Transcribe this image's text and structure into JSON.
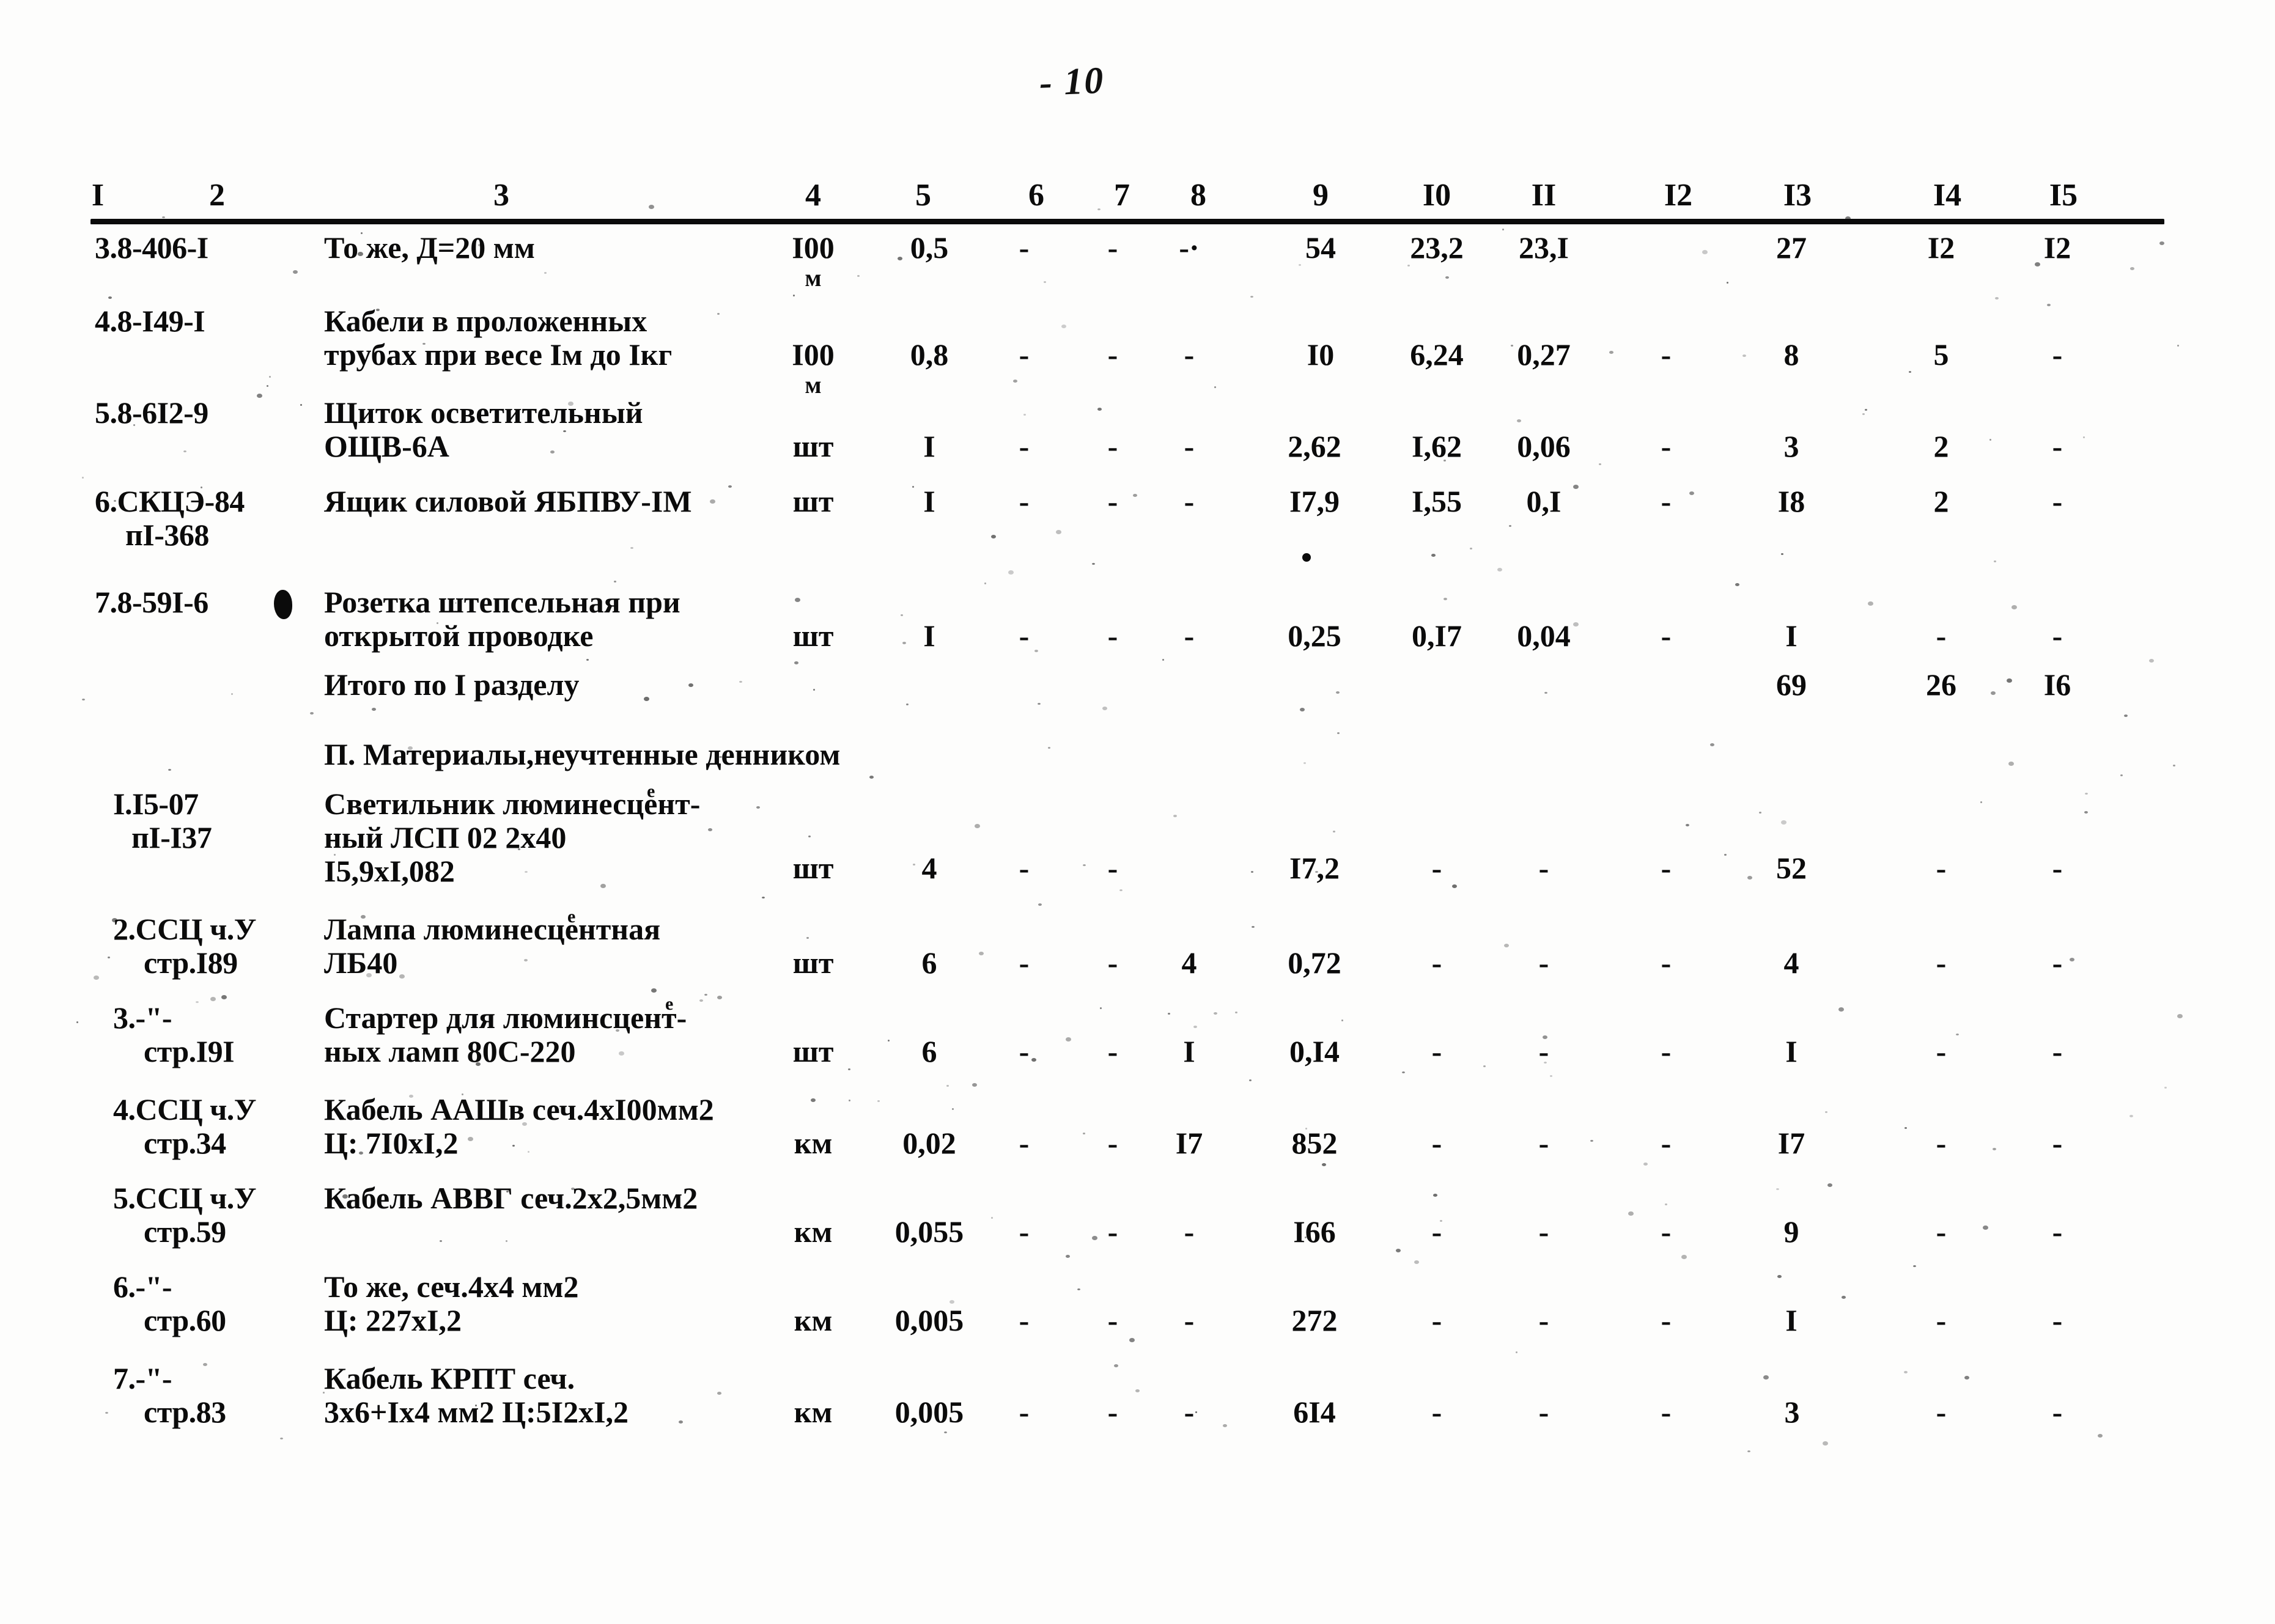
{
  "page": {
    "number_mark": "- 10",
    "paper_color": "#fdfdfc",
    "ink_color": "#0b0b0b"
  },
  "table": {
    "columns": [
      "I",
      "2",
      "3",
      "4",
      "5",
      "6",
      "7",
      "8",
      "9",
      "I0",
      "II",
      "I2",
      "I3",
      "I4",
      "I5"
    ],
    "section1_rows": [
      {
        "code": "3.8-406-I",
        "desc_lines": [
          "То же, Д=20 мм"
        ],
        "unit": "I00",
        "unit2": "м",
        "c5": "0,5",
        "c6": "-",
        "c7": "-",
        "c8": "-·",
        "c9": "54",
        "c10": "23,2",
        "c11": "23,I",
        "c12": "",
        "c13": "27",
        "c14": "I2",
        "c15": "I2"
      },
      {
        "code": "4.8-I49-I",
        "desc_lines": [
          "Кабели в проложенных",
          "трубах при весе Iм до Iкг"
        ],
        "unit": "I00",
        "unit2": "м",
        "c5": "0,8",
        "c6": "-",
        "c7": "-",
        "c8": "-",
        "c9": "I0",
        "c10": "6,24",
        "c11": "0,27",
        "c12": "-",
        "c13": "8",
        "c14": "5",
        "c15": "-"
      },
      {
        "code": "5.8-6I2-9",
        "desc_lines": [
          "Щиток осветительный",
          "ОЩВ-6А"
        ],
        "unit": "шт",
        "unit2": "",
        "c5": "I",
        "c6": "-",
        "c7": "-",
        "c8": "-",
        "c9": "2,62",
        "c10": "I,62",
        "c11": "0,06",
        "c12": "-",
        "c13": "3",
        "c14": "2",
        "c15": "-"
      },
      {
        "code": "6.СКЦЭ-84",
        "code2": "пI-368",
        "desc_lines": [
          "Ящик силовой ЯБПВУ-IМ"
        ],
        "unit": "шт",
        "unit2": "",
        "c5": "I",
        "c6": "-",
        "c7": "-",
        "c8": "-",
        "c9": "I7,9",
        "c10": "I,55",
        "c11": "0,I",
        "c12": "-",
        "c13": "I8",
        "c14": "2",
        "c15": "-"
      },
      {
        "code": "7.8-59I-6",
        "desc_lines": [
          "Розетка штепсельная при",
          "открытой проводке"
        ],
        "unit": "шт",
        "unit2": "",
        "c5": "I",
        "c6": "-",
        "c7": "-",
        "c8": "-",
        "c9": "0,25",
        "c10": "0,I7",
        "c11": "0,04",
        "c12": "-",
        "c13": "I",
        "c14": "-",
        "c15": "-"
      }
    ],
    "total_row": {
      "label": "Итого по I разделу",
      "c13": "69",
      "c14": "26",
      "c15": "I6"
    },
    "section2_heading": "П. Материалы,неучтенные денником",
    "section2_rows": [
      {
        "code": "I.I5-07",
        "code2": "пI-I37",
        "desc_lines": [
          "Светильник люминесцент-",
          "ный ЛСП 02 2х40",
          "I5,9xI,082"
        ],
        "sup_char": "е",
        "unit": "шт",
        "c5": "4",
        "c6": "-",
        "c7": "-",
        "c8": "",
        "c9": "I7,2",
        "c10": "-",
        "c11": "-",
        "c12": "-",
        "c13": "52",
        "c14": "-",
        "c15": "-"
      },
      {
        "code": "2.ССЦ ч.У",
        "code2": "стр.I89",
        "desc_lines": [
          "Лампа люминесцентная",
          "ЛБ40"
        ],
        "sup_char": "е",
        "unit": "шт",
        "c5": "6",
        "c6": "-",
        "c7": "-",
        "c8": "4",
        "c9": "0,72",
        "c10": "-",
        "c11": "-",
        "c12": "-",
        "c13": "4",
        "c14": "-",
        "c15": "-"
      },
      {
        "code": "3.-\"-",
        "code2": "стр.I9I",
        "desc_lines": [
          "Стартер для люминсцент-",
          "ных ламп 80С-220"
        ],
        "sup_char": "е",
        "unit": "шт",
        "c5": "6",
        "c6": "-",
        "c7": "-",
        "c8": "I",
        "c9": "0,I4",
        "c10": "-",
        "c11": "-",
        "c12": "-",
        "c13": "I",
        "c14": "-",
        "c15": "-"
      },
      {
        "code": "4.ССЦ ч.У",
        "code2": "стр.34",
        "desc_lines": [
          "Кабель ААШв сеч.4хI00мм2",
          "Ц: 7I0xI,2"
        ],
        "unit": "км",
        "c5": "0,02",
        "c6": "-",
        "c7": "-",
        "c8": "I7",
        "c9": "852",
        "c10": "-",
        "c11": "-",
        "c12": "-",
        "c13": "I7",
        "c14": "-",
        "c15": "-"
      },
      {
        "code": "5.ССЦ ч.У",
        "code2": "стр.59",
        "desc_lines": [
          "Кабель АВВГ сеч.2х2,5мм2"
        ],
        "unit": "км",
        "c5": "0,055",
        "c6": "-",
        "c7": "-",
        "c8": "-",
        "c9": "I66",
        "c10": "-",
        "c11": "-",
        "c12": "-",
        "c13": "9",
        "c14": "-",
        "c15": "-"
      },
      {
        "code": "6.-\"-",
        "code2": "стр.60",
        "desc_lines": [
          "То же, сеч.4х4 мм2",
          "Ц: 227xI,2"
        ],
        "unit": "км",
        "c5": "0,005",
        "c6": "-",
        "c7": "-",
        "c8": "-",
        "c9": "272",
        "c10": "-",
        "c11": "-",
        "c12": "-",
        "c13": "I",
        "c14": "-",
        "c15": "-"
      },
      {
        "code": "7.-\"-",
        "code2": "стр.83",
        "desc_lines": [
          "Кабель КРПТ сеч.",
          "3х6+Iх4 мм2 Ц:5I2xI,2"
        ],
        "unit": "км",
        "c5": "0,005",
        "c6": "-",
        "c7": "-",
        "c8": "-",
        "c9": "6I4",
        "c10": "-",
        "c11": "-",
        "c12": "-",
        "c13": "3",
        "c14": "-",
        "c15": "-"
      }
    ]
  }
}
